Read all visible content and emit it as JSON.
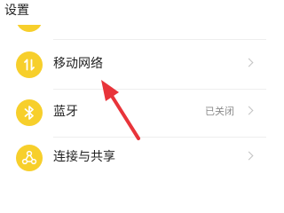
{
  "header": {
    "title": "设置"
  },
  "settings": {
    "items": [
      {
        "label": "移动网络",
        "status": "",
        "icon": "mobile-data-icon"
      },
      {
        "label": "蓝牙",
        "status": "已关闭",
        "icon": "bluetooth-icon"
      },
      {
        "label": "连接与共享",
        "status": "",
        "icon": "connection-sharing-icon"
      }
    ]
  },
  "colors": {
    "icon_background": "#f7cf2b",
    "annotation_arrow": "#e8343a",
    "text_primary": "#222222",
    "text_secondary": "#8a8a8a"
  }
}
